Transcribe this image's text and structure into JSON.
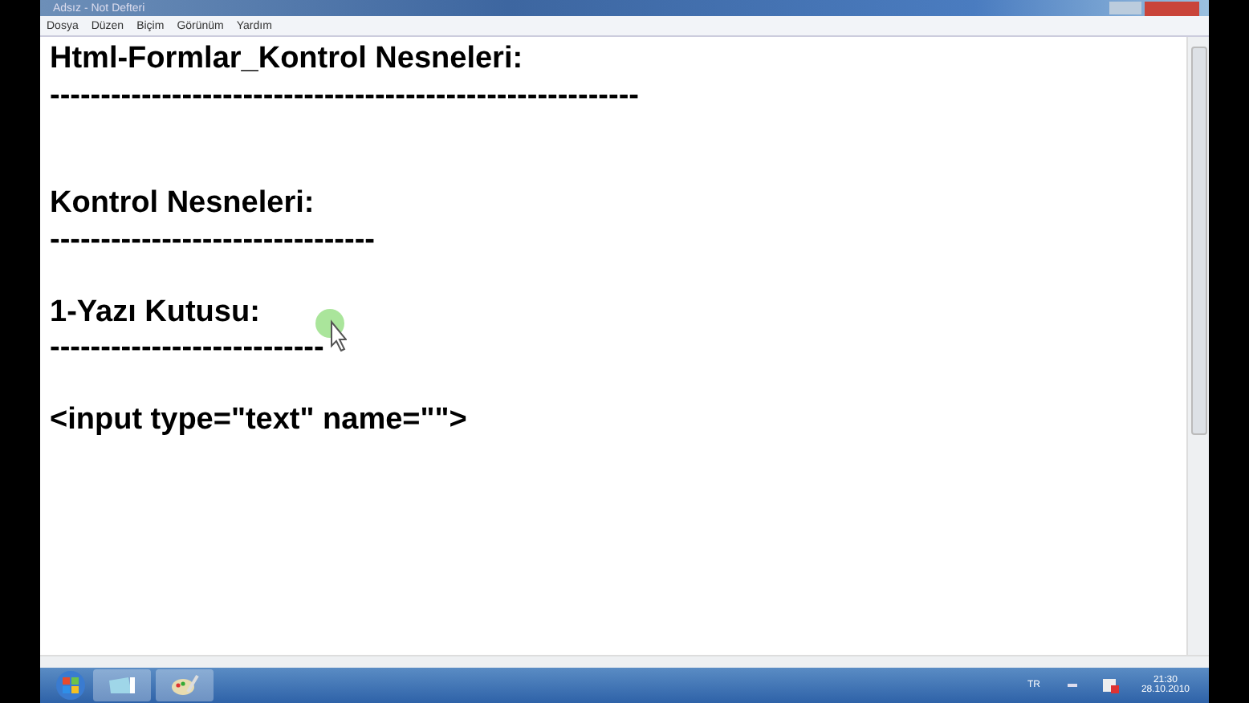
{
  "window": {
    "title": "Adsız - Not Defteri"
  },
  "menu": [
    "Dosya",
    "Düzen",
    "Biçim",
    "Görünüm",
    "Yardım"
  ],
  "lines": [
    {
      "kind": "text",
      "text": "Html-Formlar_Kontrol Nesneleri:"
    },
    {
      "kind": "text",
      "text": "----------------------------------------------------------"
    },
    {
      "kind": "blank"
    },
    {
      "kind": "blank"
    },
    {
      "kind": "text",
      "text": "Kontrol Nesneleri:"
    },
    {
      "kind": "text",
      "text": "--------------------------------"
    },
    {
      "kind": "blank"
    },
    {
      "kind": "text",
      "text": "1-Yazı Kutusu:"
    },
    {
      "kind": "text",
      "text": "---------------------------"
    },
    {
      "kind": "blank"
    },
    {
      "kind": "text",
      "text": "<input type=\"text\" name=\"\">"
    }
  ],
  "taskbar": {
    "language": "TR",
    "time": "21:30",
    "date": "28.10.2010"
  }
}
